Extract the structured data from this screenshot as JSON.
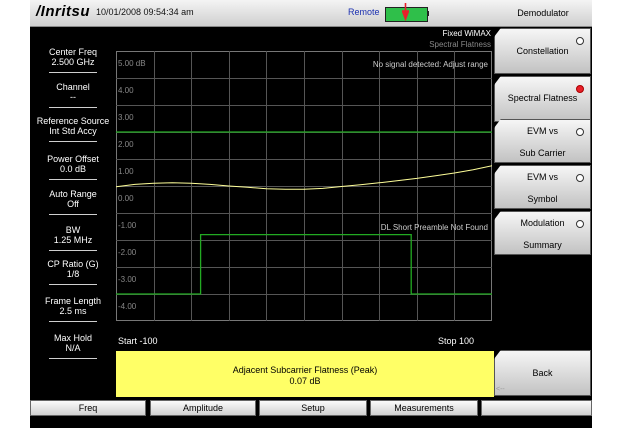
{
  "header": {
    "brand": "/Inritsu",
    "datetime": "10/01/2008 09:54:34 am",
    "remote": "Remote"
  },
  "params": [
    {
      "label": "Center Freq",
      "value": "2.500 GHz"
    },
    {
      "label": "Channel",
      "value": "--"
    },
    {
      "label": "Reference Source",
      "value": "Int Std Accy"
    },
    {
      "label": "Power Offset",
      "value": "0.0 dB"
    },
    {
      "label": "Auto Range",
      "value": "Off"
    },
    {
      "label": "BW",
      "value": "1.25 MHz"
    },
    {
      "label": "CP Ratio (G)",
      "value": "1/8"
    },
    {
      "label": "Frame Length",
      "value": "2.5 ms"
    },
    {
      "label": "Max Hold",
      "value": "N/A"
    }
  ],
  "graph": {
    "title": "Fixed WiMAX",
    "subtitle": "Spectral Flatness",
    "message": "No signal detected: Adjust range",
    "ylabels": [
      "5.00 dB",
      "4.00",
      "3.00",
      "2.00",
      "1.00",
      "0.00",
      "-1.00",
      "-2.00",
      "-3.00",
      "-4.00"
    ],
    "dl_message": "DL  Short Preamble Not Found",
    "start_label": "Start -100",
    "stop_label": "Stop 100"
  },
  "chart_data": {
    "type": "line",
    "title": "Spectral Flatness",
    "xlabel": "",
    "ylabel": "",
    "xlim": [
      -100,
      100
    ],
    "ylim": [
      -5,
      5
    ],
    "grid": true,
    "series": [
      {
        "color": "#ffff99",
        "x": [
          -100,
          -90,
          -80,
          -70,
          -60,
          -50,
          -40,
          -30,
          -20,
          -10,
          0,
          10,
          20,
          30,
          40,
          50,
          60,
          70,
          80,
          90,
          100
        ],
        "values": [
          -0.03,
          0.06,
          0.1,
          0.12,
          0.1,
          0.06,
          0.0,
          -0.05,
          -0.1,
          -0.12,
          -0.12,
          -0.09,
          -0.02,
          0.05,
          0.12,
          0.2,
          0.28,
          0.38,
          0.48,
          0.6,
          0.75
        ]
      },
      {
        "color": "#22aa22",
        "x": [
          -100,
          100
        ],
        "values": [
          2.0,
          2.0
        ]
      },
      {
        "color": "#22aa22",
        "x": [
          -100,
          -55,
          -55,
          57,
          57,
          100
        ],
        "values": [
          -4.0,
          -4.0,
          -1.8,
          -1.8,
          -4.0,
          -4.0
        ]
      }
    ]
  },
  "result": {
    "name": "Adjacent Subcarrier Flatness (Peak)",
    "value": "0.07 dB"
  },
  "menu": {
    "title": "Demodulator",
    "keys": [
      {
        "l1": "Constellation",
        "l2": "",
        "selected": false
      },
      {
        "l1": "Spectral Flatness",
        "l2": "",
        "selected": true
      },
      {
        "l1": "EVM vs",
        "l2": "Sub Carrier",
        "selected": false
      },
      {
        "l1": "EVM vs",
        "l2": "Symbol",
        "selected": false
      },
      {
        "l1": "Modulation",
        "l2": "Summary",
        "selected": false
      }
    ],
    "back": "Back",
    "back_arrow": "<--"
  },
  "bottom": [
    "Freq",
    "Amplitude",
    "Setup",
    "Measurements",
    ""
  ]
}
